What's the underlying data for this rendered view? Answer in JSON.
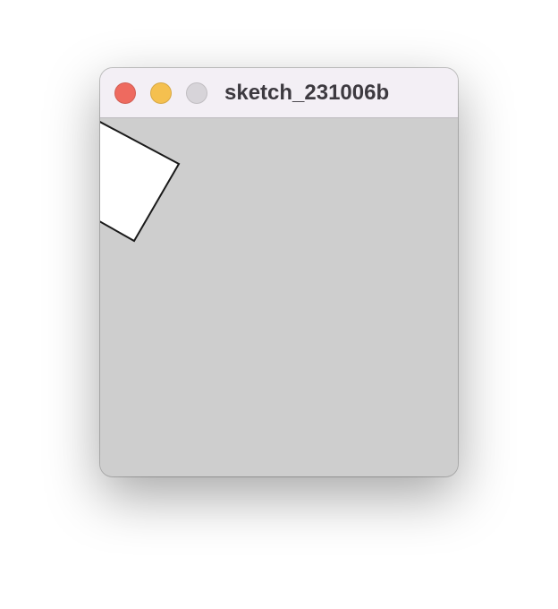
{
  "window": {
    "title": "sketch_231006b",
    "controls": {
      "close_color": "#ee6a5f",
      "minimize_color": "#f5c04f",
      "zoom_color": "#d7d4d9"
    }
  },
  "sketch": {
    "background_color": "#cecece",
    "shape": {
      "type": "rotated-square",
      "fill": "#ffffff",
      "stroke": "#1a1a1a"
    }
  }
}
